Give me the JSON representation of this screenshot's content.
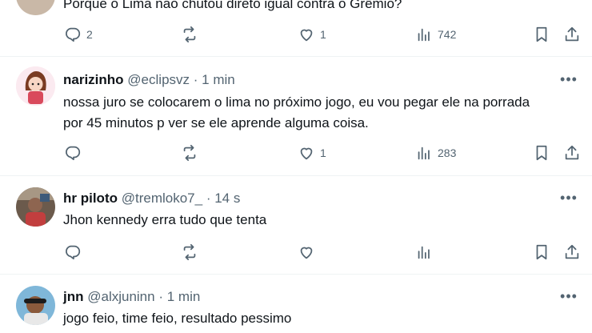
{
  "posts": [
    {
      "text": "Porque o Lima não chutou direto igual contra o Grêmio?",
      "replies": "2",
      "reposts": "",
      "likes": "1",
      "views": "742"
    },
    {
      "name": "narizinho",
      "handle": "@eclipsvz",
      "dot": "·",
      "time": "1 min",
      "text": "nossa juro se colocarem o lima no próximo jogo, eu vou pegar ele na porrada\npor 45 minutos p ver se ele aprende alguma coisa.",
      "replies": "",
      "reposts": "",
      "likes": "1",
      "views": "283",
      "more": "•••"
    },
    {
      "name": "hr piloto",
      "handle": "@tremloko7_",
      "dot": "·",
      "time": "14 s",
      "text": "Jhon kennedy erra tudo que tenta",
      "replies": "",
      "reposts": "",
      "likes": "",
      "views": "",
      "more": "•••"
    },
    {
      "name": "jnn",
      "handle": "@alxjuninn",
      "dot": "·",
      "time": "1 min",
      "text": "jogo feio, time feio, resultado pessimo",
      "more": "•••"
    }
  ],
  "icons": {
    "reply": "reply-icon",
    "repost": "repost-icon",
    "like": "like-icon",
    "views": "views-icon",
    "bookmark": "bookmark-icon",
    "share": "share-icon",
    "more": "more-icon"
  },
  "colors": {
    "text": "#0f1419",
    "secondary": "#536471",
    "divider": "#eff3f4"
  }
}
